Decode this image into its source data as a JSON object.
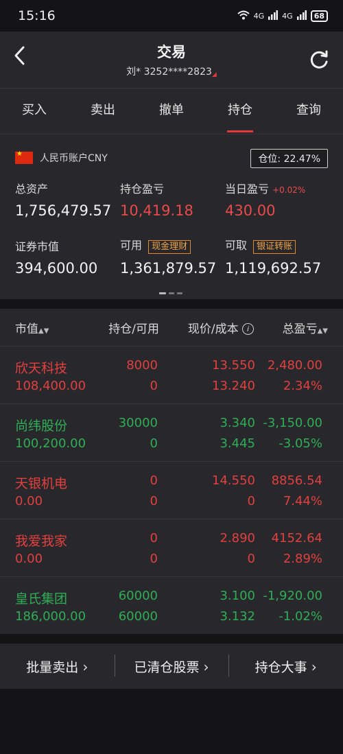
{
  "status": {
    "time": "15:16",
    "net1": "4G",
    "net2": "4G",
    "battery": "68"
  },
  "header": {
    "title": "交易",
    "subtitle": "刘* 3252****2823"
  },
  "tabs": [
    "买入",
    "卖出",
    "撤单",
    "持仓",
    "查询"
  ],
  "active_tab": "持仓",
  "account": {
    "name": "人民币账户CNY",
    "position_label": "仓位:",
    "position_value": "22.47%",
    "total_assets_label": "总资产",
    "total_assets": "1,756,479.57",
    "holding_pnl_label": "持仓盈亏",
    "holding_pnl": "10,419.18",
    "daily_pnl_label": "当日盈亏",
    "daily_pnl_pct": "+0.02%",
    "daily_pnl": "430.00",
    "market_value_label": "证券市值",
    "market_value": "394,600.00",
    "available_label": "可用",
    "available_tag": "现金理财",
    "available": "1,361,879.57",
    "withdrawable_label": "可取",
    "withdrawable_tag": "银证转账",
    "withdrawable": "1,119,692.57"
  },
  "table_header": {
    "col1": "市值",
    "col2": "持仓/可用",
    "col3": "现价/成本",
    "col4": "总盈亏"
  },
  "holdings": [
    {
      "name": "欣天科技",
      "market_value": "108,400.00",
      "qty": "8000",
      "avail": "0",
      "price": "13.550",
      "cost": "13.240",
      "pnl": "2,480.00",
      "pnl_pct": "2.34%",
      "color": "red"
    },
    {
      "name": "尚纬股份",
      "market_value": "100,200.00",
      "qty": "30000",
      "avail": "0",
      "price": "3.340",
      "cost": "3.445",
      "pnl": "-3,150.00",
      "pnl_pct": "-3.05%",
      "color": "green"
    },
    {
      "name": "天银机电",
      "market_value": "0.00",
      "qty": "0",
      "avail": "0",
      "price": "14.550",
      "cost": "0",
      "pnl": "8856.54",
      "pnl_pct": "7.44%",
      "color": "red"
    },
    {
      "name": "我爱我家",
      "market_value": "0.00",
      "qty": "0",
      "avail": "0",
      "price": "2.890",
      "cost": "0",
      "pnl": "4152.64",
      "pnl_pct": "2.89%",
      "color": "red"
    },
    {
      "name": "皇氏集团",
      "market_value": "186,000.00",
      "qty": "60000",
      "avail": "60000",
      "price": "3.100",
      "cost": "3.132",
      "pnl": "-1,920.00",
      "pnl_pct": "-1.02%",
      "color": "green"
    }
  ],
  "actions": [
    "批量卖出",
    "已清仓股票",
    "持仓大事"
  ],
  "colors": {
    "up": "#e2403f",
    "down": "#2fae55",
    "accent": "#e53935",
    "tag": "#e08a2e"
  }
}
